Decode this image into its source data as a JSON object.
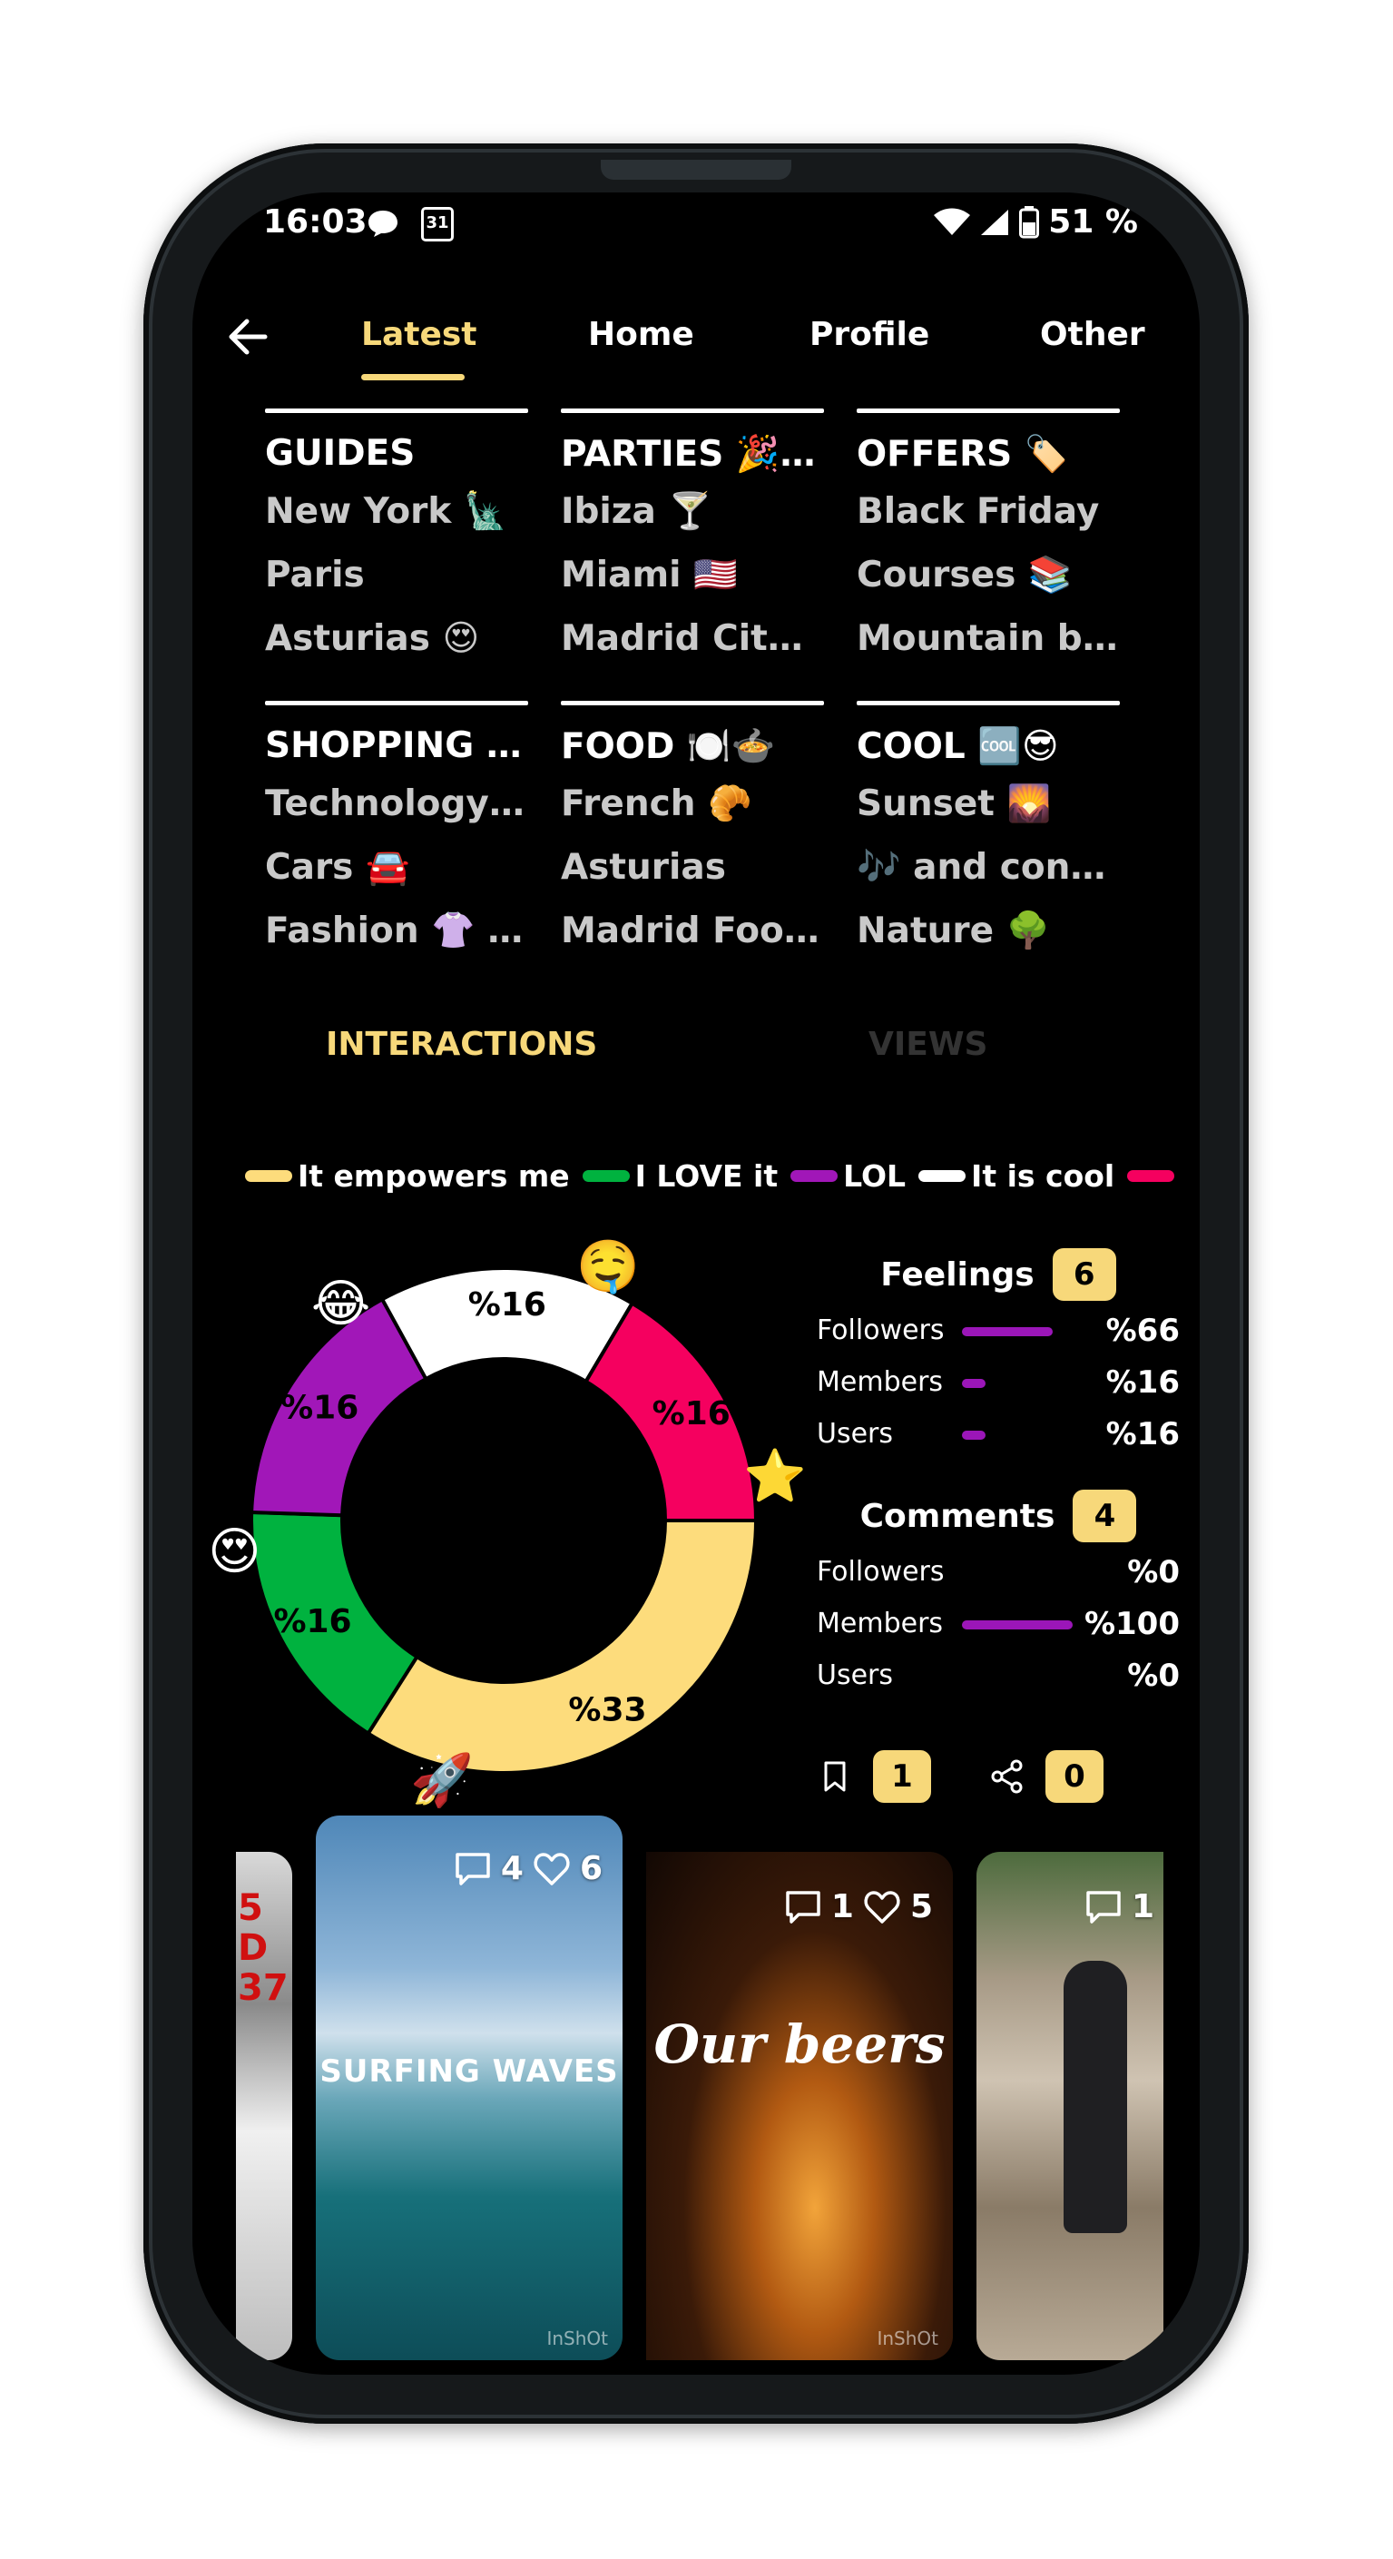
{
  "status_bar": {
    "time": "16:03",
    "calendar_day": "31",
    "battery": "51 %"
  },
  "tabs": {
    "items": [
      "Latest",
      "Home",
      "Profile",
      "Other"
    ],
    "active": "Latest"
  },
  "categories": [
    {
      "title": "GUIDES",
      "items": [
        "New York 🗽",
        "Paris",
        "Asturias 😍"
      ]
    },
    {
      "title": "PARTIES 🎉 Events",
      "items": [
        "Ibiza 🍸",
        "Miami 🇺🇸",
        "Madrid City Nights"
      ]
    },
    {
      "title": "OFFERS 🏷️",
      "items": [
        "Black Friday",
        "Courses 📚",
        "Mountain bikes"
      ]
    },
    {
      "title": "SHOPPING Centers",
      "items": [
        "Technology Stores",
        "Cars 🚘",
        "Fashion 👚 Trends"
      ]
    },
    {
      "title": "FOOD 🍽️🍲",
      "items": [
        "French 🥐",
        "Asturias",
        "Madrid Food Tours"
      ]
    },
    {
      "title": "COOL 🆒😎",
      "items": [
        "Sunset 🌄",
        "🎶 and concerts",
        "Nature 🌳"
      ]
    }
  ],
  "section_tabs": {
    "interactions": "INTERACTIONS",
    "views": "VIEWS",
    "active": "interactions"
  },
  "legend": [
    {
      "label": "It empowers me",
      "color": "#fddc7c"
    },
    {
      "label": "I LOVE it",
      "color": "#00b23f"
    },
    {
      "label": "LOL",
      "color": "#a117b8"
    },
    {
      "label": "It is cool",
      "color": "#ffffff"
    },
    {
      "label": "",
      "color": "#f5005f"
    }
  ],
  "chart_data": {
    "type": "pie",
    "donut": true,
    "slices": [
      {
        "label": "It empowers me",
        "value": 33,
        "display": "%33",
        "color": "#fddc7c",
        "emoji": "🚀"
      },
      {
        "label": "I LOVE it",
        "value": 16,
        "display": "%16",
        "color": "#00b23f",
        "emoji": "😍"
      },
      {
        "label": "LOL",
        "value": 16,
        "display": "%16",
        "color": "#a117b8",
        "emoji": "😂"
      },
      {
        "label": "It is cool",
        "value": 16,
        "display": "%16",
        "color": "#ffffff",
        "emoji": "🤤"
      },
      {
        "label": "",
        "value": 16,
        "display": "%16",
        "color": "#f5005f",
        "emoji": "⭐"
      }
    ]
  },
  "feelings": {
    "title": "Feelings",
    "count": "6",
    "rows": [
      {
        "label": "Followers",
        "value": "%66",
        "percent": 66
      },
      {
        "label": "Members",
        "value": "%16",
        "percent": 16
      },
      {
        "label": "Users",
        "value": "%16",
        "percent": 16
      }
    ]
  },
  "comments": {
    "title": "Comments",
    "count": "4",
    "rows": [
      {
        "label": "Followers",
        "value": "%0",
        "percent": 0
      },
      {
        "label": "Members",
        "value": "%100",
        "percent": 100
      },
      {
        "label": "Users",
        "value": "%0",
        "percent": 0
      }
    ]
  },
  "saves": {
    "count": "1"
  },
  "shares": {
    "count": "0"
  },
  "videos": [
    {
      "comments": "",
      "likes": "",
      "title": ""
    },
    {
      "comments": "4",
      "likes": "6",
      "title": "SURFING WAVES",
      "watermark": "InShOt"
    },
    {
      "comments": "1",
      "likes": "5",
      "title": "Our beers",
      "watermark": "InShOt"
    },
    {
      "comments": "1",
      "likes": "",
      "title": ""
    }
  ]
}
